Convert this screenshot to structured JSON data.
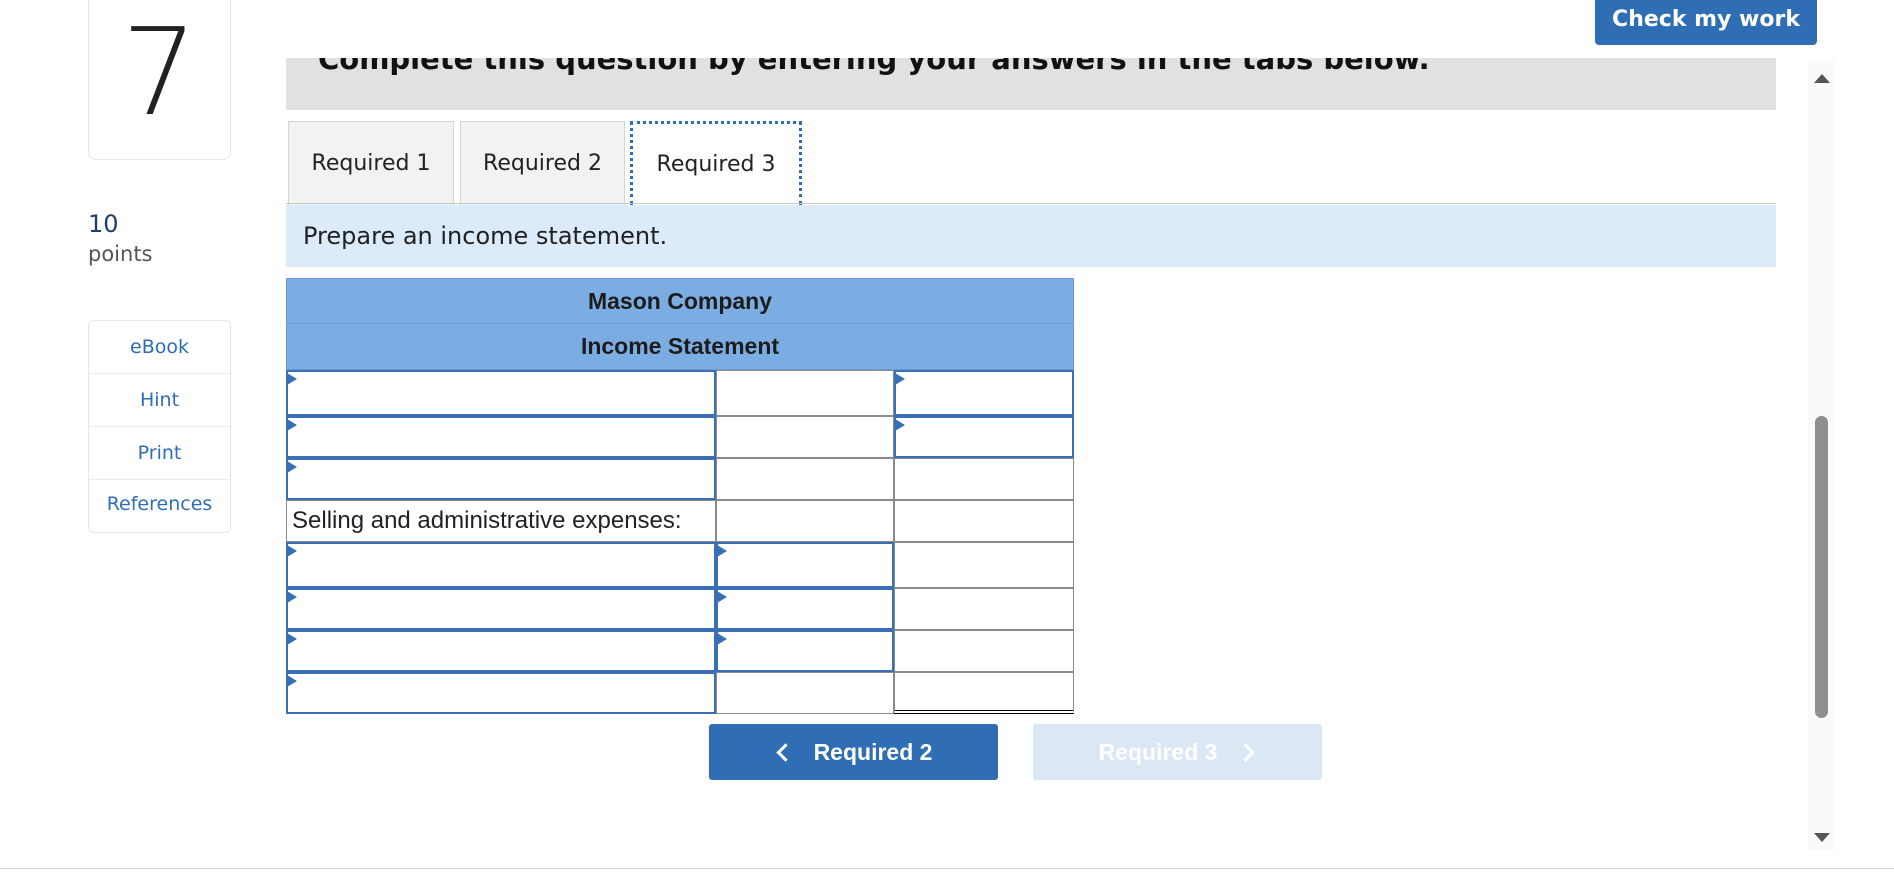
{
  "question": {
    "number": "7",
    "points_value": "10",
    "points_label": "points"
  },
  "tools": [
    "eBook",
    "Hint",
    "Print",
    "References"
  ],
  "header": {
    "check_button": "Check my work"
  },
  "instruction": "Complete this question by entering your answers in the tabs below.",
  "tabs": [
    {
      "label": "Required 1",
      "active": false
    },
    {
      "label": "Required 2",
      "active": false
    },
    {
      "label": "Required 3",
      "active": true
    }
  ],
  "prompt": "Prepare an income statement.",
  "statement": {
    "company": "Mason Company",
    "title": "Income Statement",
    "row_label": "Selling and administrative expenses:"
  },
  "nav": {
    "prev_label": "Required 2",
    "next_label": "Required 3"
  },
  "colors": {
    "accent": "#2f6db5",
    "header_fill": "#7bade3",
    "prompt_fill": "#dcebfa"
  }
}
